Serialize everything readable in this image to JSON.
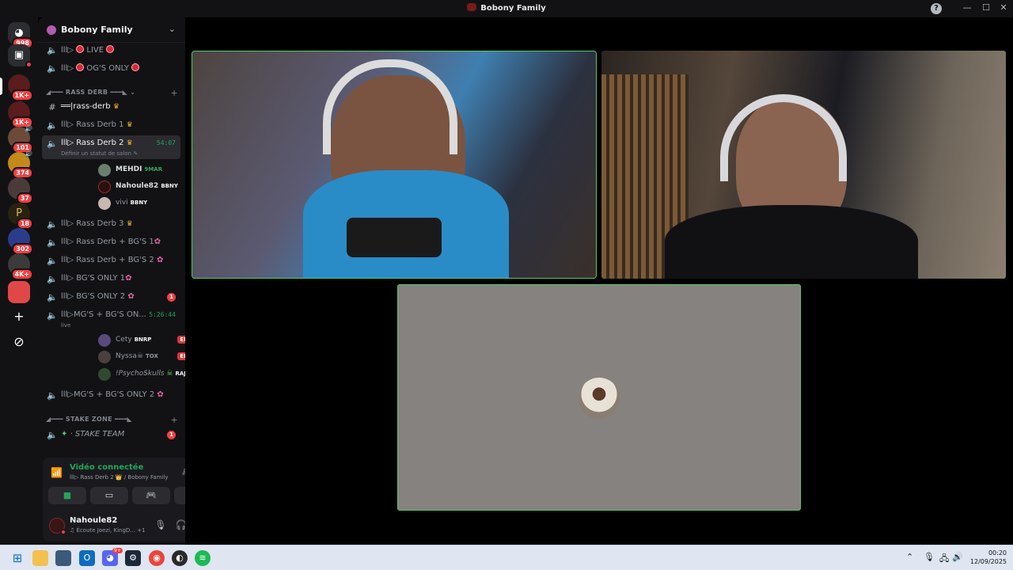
{
  "window": {
    "title": "Bobony Family"
  },
  "server_rail": {
    "badges": [
      "998",
      "1K+",
      "1K+",
      "101",
      "374",
      "37",
      "18",
      "302",
      "4K+"
    ]
  },
  "guild": {
    "name": "Bobony Family"
  },
  "channels": {
    "live": "lll▷",
    "live_label": "LIVE",
    "og": "lll▷",
    "og_label": "OG'S ONLY",
    "cat1": "◢━━━ RASS DERB ━━━◣",
    "rass_derb_text": "══|rass-derb",
    "rd1": "lll▷ Rass Derb 1",
    "rd2": "lll▷ Rass Derb 2",
    "rd2_timer": "54:07",
    "rd2_status": "Définir un statut de salon",
    "rd3": "lll▷ Rass Derb 3",
    "rdbg1": "lll▷ Rass Derb + BG'S 1",
    "rdbg2": "lll▷ Rass Derb + BG'S 2",
    "bg1": "lll▷ BG'S ONLY 1",
    "bg2": "lll▷ BG'S ONLY 2",
    "bg2_badge": "1",
    "mg1": "lll▷MG'S + BG'S ON...",
    "mg1_timer": "5:26:44",
    "mg1_status": "live",
    "mg2": "lll▷MG'S + BG'S ONLY 2",
    "cat2": "◢━━━ STAKE ZONE ━━━◣",
    "stake": "· STAKE TEAM",
    "stake_badge": "1"
  },
  "voice_users_rd2": [
    {
      "name": "MEHDI",
      "tag": "9MAR"
    },
    {
      "name": "Nahoule82",
      "tag": "BBNY"
    },
    {
      "name": "vivi",
      "tag": "BBNY"
    }
  ],
  "voice_users_mg1": [
    {
      "name": "Cety",
      "tag": "BNRP",
      "live": "EN DIRECT"
    },
    {
      "name": "Nyssa☠",
      "tag": "TOX",
      "live": "EN DIRECT"
    },
    {
      "name": "!PsychoSkulls",
      "tag": "RAJA"
    }
  ],
  "voice_panel": {
    "status": "Vidéo connectée",
    "location": "lll▷ Rass Derb 2 👑 / Bobony Family"
  },
  "user": {
    "name": "Nahoule82",
    "activity": "Écoute Joezi, KingD...",
    "extra": "+1"
  },
  "taskbar": {
    "time": "00:20",
    "date": "12/09/2025",
    "steam_badge": "9+"
  }
}
